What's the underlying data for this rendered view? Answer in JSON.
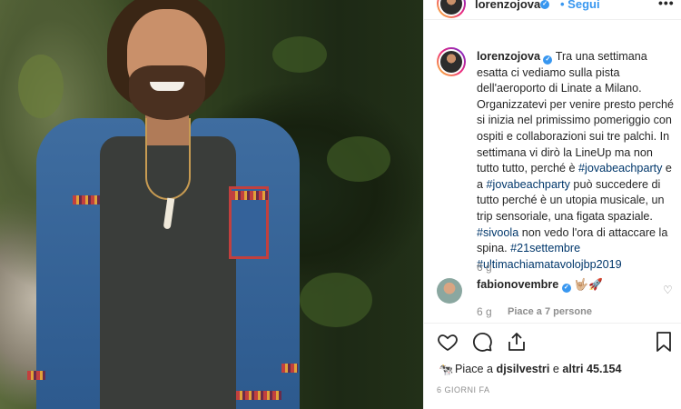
{
  "header": {
    "username": "lorenzojova",
    "follow_label": "Segui",
    "more_label": "•••"
  },
  "post": {
    "username": "lorenzojova",
    "caption_parts": {
      "p1": "Tra una settimana esatta ci vediamo sulla pista dell'aeroporto di Linate a Milano. Organizzatevi per venire presto perché si inizia nel primissimo pomeriggio con ospiti e collaborazioni sui tre palchi. In settimana vi dirò la LineUp ma non tutto tutto, perché è ",
      "tag1": "#jovabeachparty",
      "p2": " e a ",
      "tag2": "#jovabeachparty",
      "p3": " può succedere di tutto perché è un utopia musicale, un trip sensoriale, una figata spaziale. ",
      "tag3": "#sivoola",
      "p4": " non vedo l'ora di attaccare la spina. ",
      "tag4": "#21settembre",
      "tag5": "#ultimachiamatavolojbp2019"
    },
    "time": "6 g"
  },
  "comment": {
    "username": "fabionovembre",
    "text": "🤟🏼🚀",
    "time": "6 g",
    "likes_label": "Piace a 7 persone"
  },
  "footer": {
    "likes_prefix": "Piace a",
    "liked_by": "djsilvestri",
    "likes_mid": "e",
    "likes_others": "altri 45.154",
    "age": "6 giorni fa"
  },
  "colors": {
    "link": "#00376b",
    "accent": "#3897f0",
    "muted": "#8e8e8e"
  },
  "icons": {
    "like": "heart-icon",
    "comment": "comment-icon",
    "share": "share-icon",
    "save": "bookmark-icon"
  }
}
